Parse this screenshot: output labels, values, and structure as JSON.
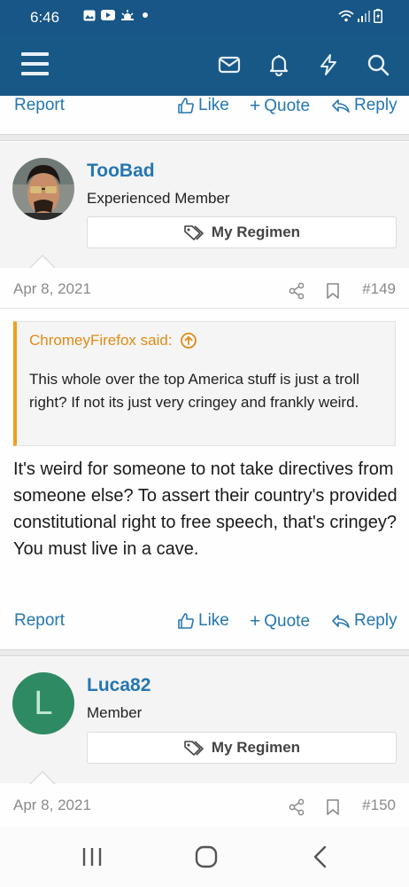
{
  "status_bar": {
    "time": "6:46",
    "left_icons": [
      "image-icon",
      "youtube-icon",
      "weather-icon",
      "dot-icon"
    ],
    "right_icons": [
      "wifi-icon",
      "signal-icon",
      "battery-icon"
    ]
  },
  "app_bar": {
    "icons": [
      "menu-icon",
      "mail-icon",
      "bell-icon",
      "bolt-icon",
      "search-icon"
    ],
    "color": "#185887"
  },
  "actions_labels": {
    "report": "Report",
    "like": "Like",
    "quote": "Quote",
    "reply": "Reply"
  },
  "posts": [
    {
      "username": "TooBad",
      "user_title": "Experienced Member",
      "regimen_label": "My Regimen",
      "date": "Apr 8, 2021",
      "number": "#149",
      "quote": {
        "author": "ChromeyFirefox said:",
        "text": "This whole over the top America stuff is just a troll right? If not its just very cringey and frankly weird."
      },
      "body": "It's weird for someone to not take directives from someone else? To assert their country's provided constitutional right to free speech, that's cringey? You must live in a cave."
    },
    {
      "username": "Luca82",
      "user_title": "Member",
      "avatar_letter": "L",
      "avatar_color": "#2e8a63",
      "regimen_label": "My Regimen",
      "date": "Apr 8, 2021",
      "number": "#150"
    }
  ],
  "colors": {
    "link": "#2577b1",
    "quote_accent": "#f0a01e"
  }
}
